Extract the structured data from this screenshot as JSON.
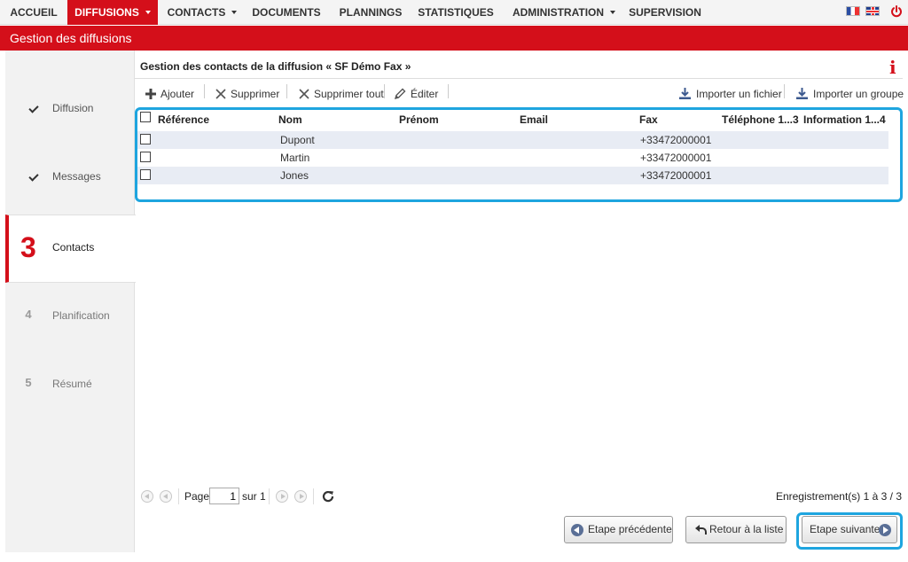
{
  "nav": {
    "items": [
      {
        "label": "ACCUEIL",
        "caret": false,
        "active": false
      },
      {
        "label": "DIFFUSIONS",
        "caret": true,
        "active": true
      },
      {
        "label": "CONTACTS",
        "caret": true,
        "active": false
      },
      {
        "label": "DOCUMENTS",
        "caret": false,
        "active": false
      },
      {
        "label": "PLANNINGS",
        "caret": false,
        "active": false
      },
      {
        "label": "STATISTIQUES",
        "caret": false,
        "active": false
      },
      {
        "label": "ADMINISTRATION",
        "caret": true,
        "active": false
      },
      {
        "label": "SUPERVISION",
        "caret": false,
        "active": false
      }
    ],
    "flags": [
      "fr-flag-icon",
      "uk-flag-icon"
    ],
    "logout_icon": "power-icon"
  },
  "header": {
    "title": "Gestion des diffusions"
  },
  "steps": [
    {
      "number": "",
      "label": "Diffusion",
      "state": "done"
    },
    {
      "number": "",
      "label": "Messages",
      "state": "done"
    },
    {
      "number": "3",
      "label": "Contacts",
      "state": "current"
    },
    {
      "number": "4",
      "label": "Planification",
      "state": "todo"
    },
    {
      "number": "5",
      "label": "Résumé",
      "state": "todo"
    }
  ],
  "panel": {
    "title": "Gestion des contacts de la diffusion « SF Démo Fax »",
    "info_icon": "i"
  },
  "toolbar": {
    "add": "Ajouter",
    "delete": "Supprimer",
    "delete_all": "Supprimer tout",
    "edit": "Éditer",
    "import_file": "Importer un fichier",
    "import_group": "Importer un groupe"
  },
  "table": {
    "columns": [
      "Référence",
      "Nom",
      "Prénom",
      "Email",
      "Fax",
      "Téléphone 1...3",
      "Information 1...4"
    ],
    "rows": [
      {
        "reference": "",
        "nom": "Dupont",
        "prenom": "",
        "email": "",
        "fax": "+33472000001",
        "telephone": "",
        "information": ""
      },
      {
        "reference": "",
        "nom": "Martin",
        "prenom": "",
        "email": "",
        "fax": "+33472000001",
        "telephone": "",
        "information": ""
      },
      {
        "reference": "",
        "nom": "Jones",
        "prenom": "",
        "email": "",
        "fax": "+33472000001",
        "telephone": "",
        "information": ""
      }
    ]
  },
  "pager": {
    "page_label": "Page",
    "page_value": "1",
    "of_label": "sur 1",
    "records": "Enregistrement(s) 1 à 3 / 3"
  },
  "footer": {
    "prev": "Etape précédente",
    "back": "Retour à la liste",
    "next": "Etape suivante"
  },
  "colors": {
    "accent": "#d40f1a",
    "highlight": "#1ea5df",
    "row_alt": "#e8ecf4"
  }
}
